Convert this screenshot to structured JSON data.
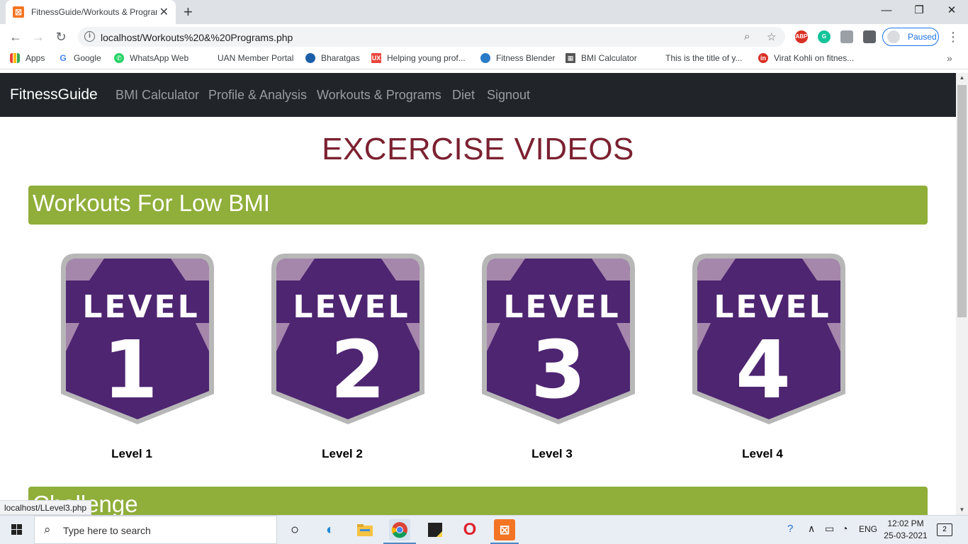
{
  "browser": {
    "tab_title": "FitnessGuide/Workouts & Programs",
    "tab_close": "✕",
    "new_tab": "+",
    "window_controls": {
      "minimize": "—",
      "maximize": "❐",
      "close": "✕"
    },
    "url": "localhost/Workouts%20&%20Programs.php",
    "profile_button": "Paused",
    "status_url": "localhost/LLevel3.php"
  },
  "bookmarks": [
    {
      "label": "Apps",
      "icon": "apps-grid-icon",
      "color": "#ea4335"
    },
    {
      "label": "Google",
      "icon": "google-icon",
      "color": "#4285f4"
    },
    {
      "label": "WhatsApp Web",
      "icon": "whatsapp-icon",
      "color": "#25d366"
    },
    {
      "label": "UAN Member Portal",
      "icon": "blank-page-icon",
      "color": "#ffffff"
    },
    {
      "label": "Bharatgas",
      "icon": "bharatgas-icon",
      "color": "#1c5fa8"
    },
    {
      "label": "Helping young prof...",
      "icon": "ux-icon",
      "color": "#e8453c"
    },
    {
      "label": "Fitness Blender",
      "icon": "fitness-blender-icon",
      "color": "#2a7bc8"
    },
    {
      "label": "BMI Calculator",
      "icon": "calculator-icon",
      "color": "#555555"
    },
    {
      "label": "This is the title of y...",
      "icon": "blank-page-icon",
      "color": "#ffffff"
    },
    {
      "label": "Virat Kohli on fitnes...",
      "icon": "red-circle-icon",
      "color": "#d93025"
    }
  ],
  "site": {
    "brand": "FitnessGuide",
    "nav": [
      "BMI Calculator",
      "Profile & Analysis",
      "Workouts & Programs",
      "Diet",
      "Signout"
    ],
    "heading": "EXCERCISE VIDEOS",
    "section_low_bmi": "Workouts For Low BMI",
    "section_challenge": "Challenge",
    "badge_word": "LEVEL",
    "levels": [
      {
        "number": "1",
        "caption": "Level 1"
      },
      {
        "number": "2",
        "caption": "Level 2"
      },
      {
        "number": "3",
        "caption": "Level 3"
      },
      {
        "number": "4",
        "caption": "Level 4"
      }
    ]
  },
  "taskbar": {
    "search_placeholder": "Type here to search",
    "language": "ENG",
    "time": "12:02 PM",
    "date": "25-03-2021",
    "notification_count": "2"
  },
  "colors": {
    "navbar": "#212529",
    "section_bar": "#8fae3a",
    "heading": "#7b2130",
    "badge_purple": "#4e2571",
    "badge_light": "#a687ac",
    "badge_border": "#b7b7b7"
  }
}
